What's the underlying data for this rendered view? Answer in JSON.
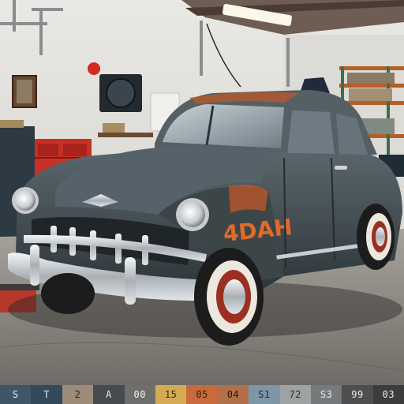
{
  "scene": {
    "car_door_lettering": "4DAH",
    "wall_sign_color": "#d42a22",
    "colors": {
      "wall": "#e4e3df",
      "floor": "#8e8a84",
      "car_body": "#4a5458",
      "car_body_dark": "#2f383c",
      "rust": "#c2572a",
      "chrome": "#d7dade",
      "tire": "#1c1c1c",
      "whitewall": "#ece8df",
      "wheel_ring": "#9b2f22",
      "cabinet_red": "#c93025",
      "cabinet_dark": "#2d3a44",
      "ceiling_light": "#fbf8ea"
    }
  },
  "palette": [
    {
      "label": "S",
      "bg": "#405565",
      "fg": "#e9edf0"
    },
    {
      "label": "T",
      "bg": "#34495a",
      "fg": "#e9edf0"
    },
    {
      "label": "2",
      "bg": "#9c8b79",
      "fg": "#26201a"
    },
    {
      "label": "A",
      "bg": "#464b4f",
      "fg": "#e8e8e8"
    },
    {
      "label": "00",
      "bg": "#6e6e6c",
      "fg": "#f2f2f2"
    },
    {
      "label": "15",
      "bg": "#d4ab53",
      "fg": "#3b2a10"
    },
    {
      "label": "05",
      "bg": "#c96a3c",
      "fg": "#3a1a0c"
    },
    {
      "label": "04",
      "bg": "#b36f4a",
      "fg": "#2c160a"
    },
    {
      "label": "S1",
      "bg": "#7d96a8",
      "fg": "#1e2a33"
    },
    {
      "label": "72",
      "bg": "#9da2a3",
      "fg": "#2a2d2e"
    },
    {
      "label": "S3",
      "bg": "#767a7d",
      "fg": "#ececec"
    },
    {
      "label": "99",
      "bg": "#4c4e50",
      "fg": "#ececec"
    },
    {
      "label": "03",
      "bg": "#3a3c3e",
      "fg": "#ececec"
    }
  ]
}
